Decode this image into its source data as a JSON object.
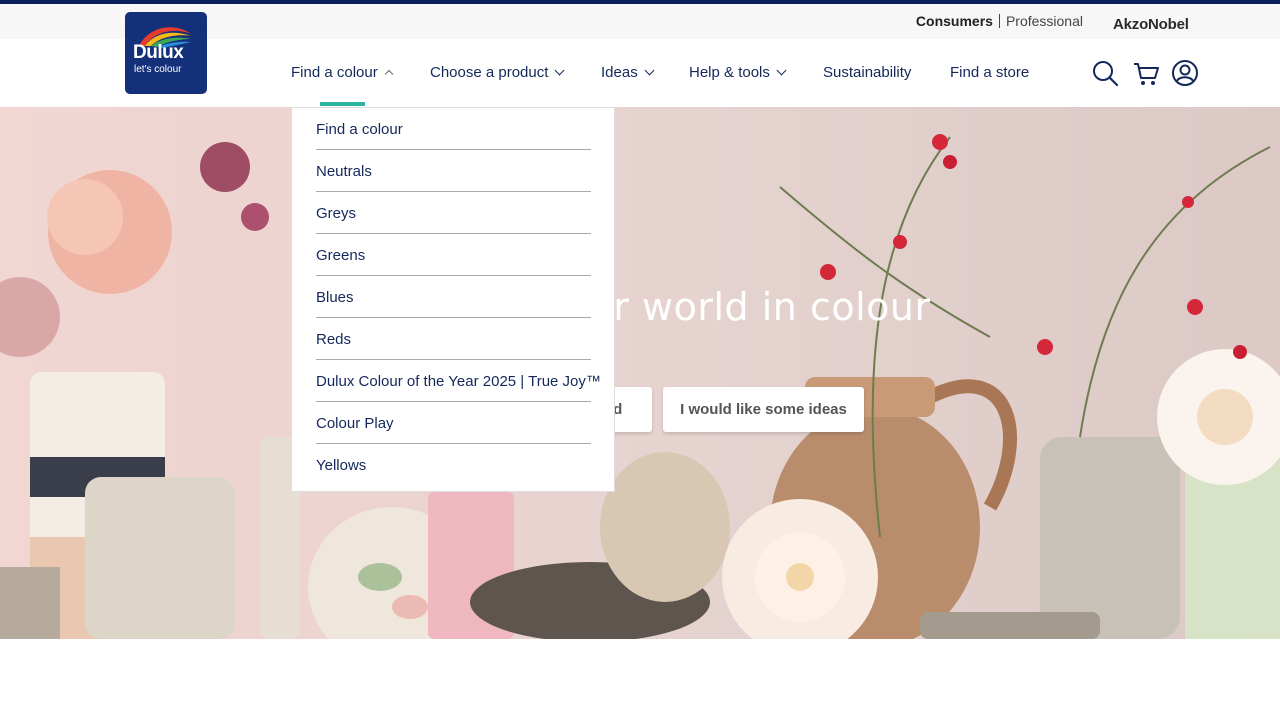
{
  "utility": {
    "consumers": "Consumers",
    "professional": "Professional",
    "akzonobel": "AkzoNobel"
  },
  "logo": {
    "brand": "Dulux",
    "tagline": "let's colour"
  },
  "nav": {
    "find_colour": "Find a colour",
    "choose_product": "Choose a product",
    "ideas": "Ideas",
    "help_tools": "Help & tools",
    "sustainability": "Sustainability",
    "find_store": "Find a store"
  },
  "icons": {
    "search": "search-icon",
    "cart": "cart-icon",
    "account": "user-account-icon"
  },
  "dropdown": {
    "items": [
      "Find a colour",
      "Neutrals",
      "Greys",
      "Greens",
      "Blues",
      "Reds",
      "Dulux Colour of the Year 2025 | True Joy™",
      "Colour Play",
      "Yellows"
    ]
  },
  "hero": {
    "title": "our world in colour",
    "btn_find": "ind",
    "btn_ideas": "I would like some ideas"
  },
  "colors": {
    "navy": "#14285a",
    "accent": "#2bb5a0",
    "logo_bg": "#15307a"
  }
}
